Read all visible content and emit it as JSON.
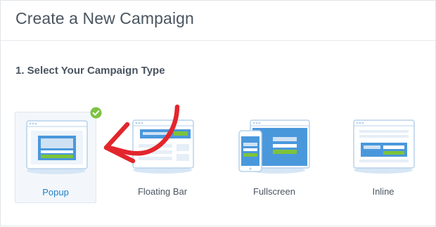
{
  "page": {
    "title": "Create a New Campaign",
    "step_title": "1. Select Your Campaign Type"
  },
  "campaign_types": [
    {
      "label": "Popup",
      "selected": true
    },
    {
      "label": "Floating Bar",
      "selected": false
    },
    {
      "label": "Fullscreen",
      "selected": false
    },
    {
      "label": "Inline",
      "selected": false
    }
  ],
  "colors": {
    "accent_blue": "#1f7fc7",
    "illustration_blue": "#4a98dc",
    "illustration_light": "#d6e6f5",
    "cta_green": "#7dc33a",
    "check_green": "#7cc242",
    "arrow_red": "#e2262c",
    "text_dark": "#4a5561"
  },
  "icons": {
    "selected_badge": "check-circle-icon",
    "annotation": "red-arrow-annotation"
  }
}
